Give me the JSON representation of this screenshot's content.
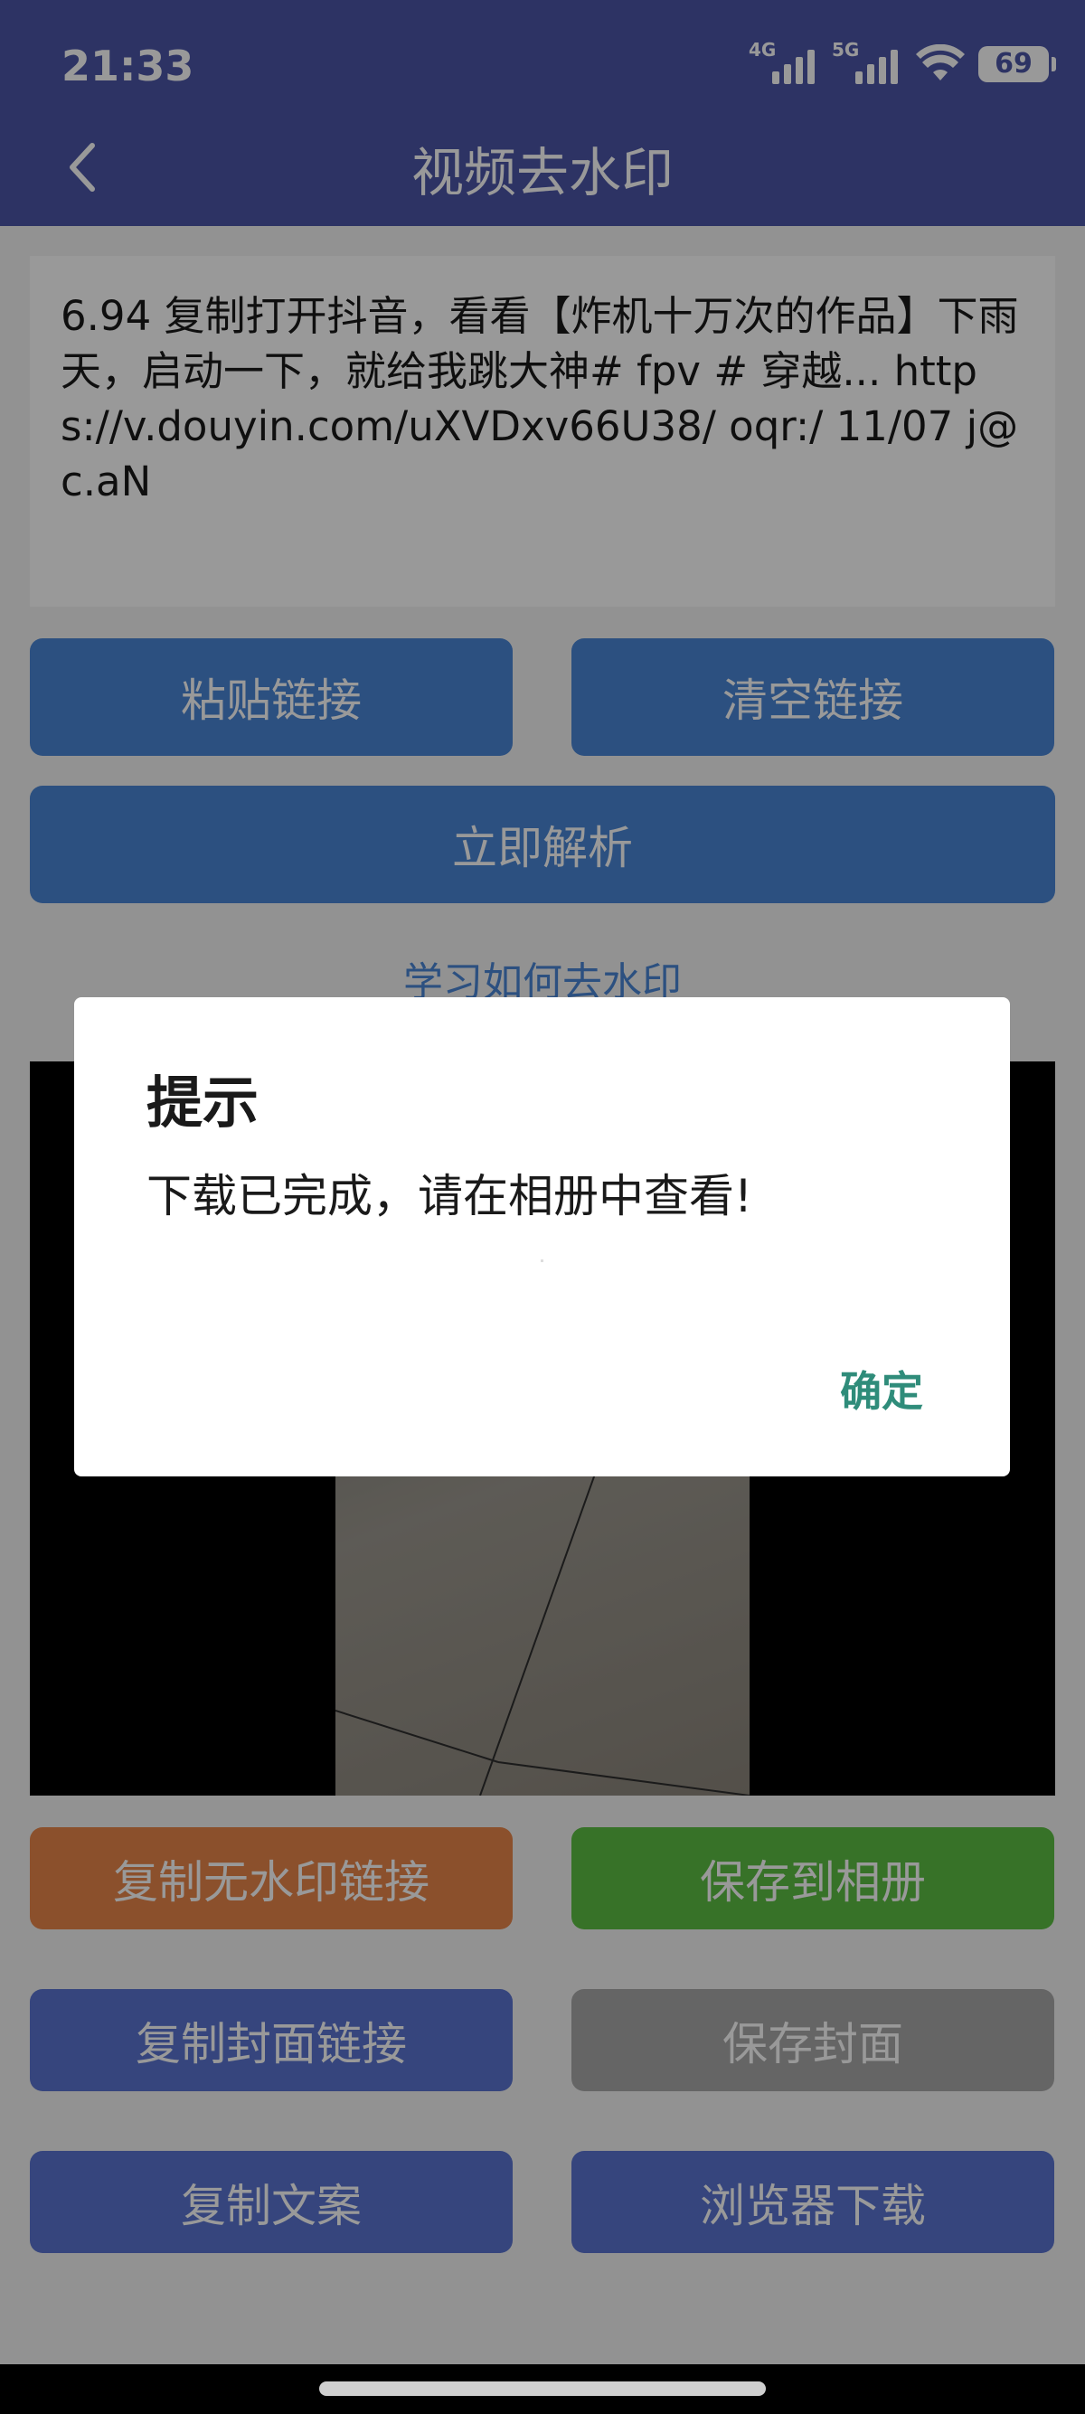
{
  "status_bar": {
    "time": "21:33",
    "network_1": "4G",
    "network_2": "5G",
    "battery": "69"
  },
  "header": {
    "title": "视频去水印",
    "back_icon": "chevron-left-icon"
  },
  "link_input": {
    "value": "6.94 复制打开抖音，看看【炸机十万次的作品】下雨天，启动一下，就给我跳大神# fpv # 穿越... https://v.douyin.com/uXVDxv66U38/ oqr:/ 11/07 j@c.aN"
  },
  "buttons": {
    "paste": "粘贴链接",
    "clear": "清空链接",
    "parse": "立即解析",
    "copy_nowatermark": "复制无水印链接",
    "save_album": "保存到相册",
    "copy_cover": "复制封面链接",
    "save_cover": "保存封面",
    "copy_text": "复制文案",
    "browser_download": "浏览器下载"
  },
  "learn_link": "学习如何去水印",
  "dialog": {
    "title": "提示",
    "message": "下载已完成，请在相册中查看!",
    "ok": "确定"
  },
  "colors": {
    "primary": "#4b55a7",
    "button_blue": "#4a86d6",
    "button_indigo": "#5a74d0",
    "button_orange": "#e8864a",
    "button_green": "#5cbf44",
    "button_gray": "#a8a8a8",
    "confirm_text": "#2f8c7a"
  }
}
